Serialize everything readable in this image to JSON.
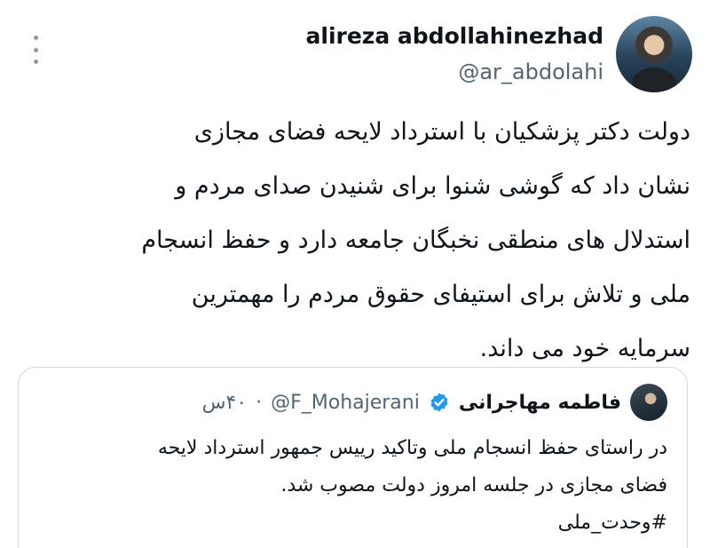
{
  "tweet": {
    "display_name": "alireza abdollahinezhad",
    "handle": "@ar_abdolahi",
    "lines": [
      "دولت دکتر پزشکیان با استرداد لایحه فضای مجازی",
      "نشان داد که گوشی شنوا برای شنیدن صدای مردم و",
      "استدلال های منطقی نخبگان جامعه دارد و حفظ انسجام",
      "ملی و تلاش برای  استیفای حقوق مردم را مهمترین",
      "سرمایه خود می داند."
    ],
    "more_icon": "more-vertical-icon"
  },
  "quote": {
    "display_name": "فاطمه مهاجرانی",
    "handle": "@F_Mohajerani",
    "separator": "·",
    "time": "۴۰س",
    "verified_icon": "verified-badge-icon",
    "verified_color": "#1d9bf0",
    "lines": [
      "در راستای حفظ انسجام ملی وتاکید رییس جمهور استرداد لایحه",
      "فضای مجازی در جلسه امروز دولت مصوب شد."
    ],
    "hashtag": "#وحدت_ملی"
  }
}
